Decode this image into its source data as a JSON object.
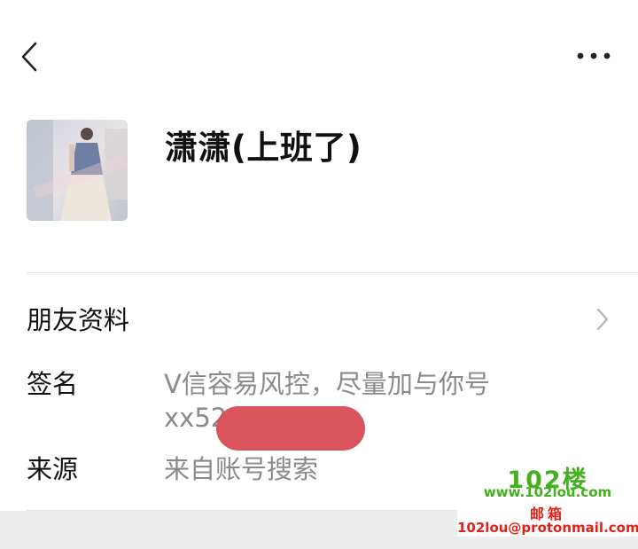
{
  "header": {
    "back_icon": "chevron-left-icon",
    "more_icon": "more-horizontal-icon"
  },
  "profile": {
    "avatar_icon": "avatar-photo",
    "nickname": "潇潇(上班了)"
  },
  "friend_info": {
    "label": "朋友资料",
    "chevron_icon": "chevron-right-icon"
  },
  "signature": {
    "label": "签名",
    "line1": "V信容易风控，尽量加与你号",
    "line2": "xx52"
  },
  "source": {
    "label": "来源",
    "value": "来自账号搜索"
  },
  "watermark": {
    "brand": "102楼",
    "site": "www.102lou.com",
    "mail_label": "邮箱",
    "mail": "102lou@protonmail.com"
  },
  "colors": {
    "redaction": "#d9545c",
    "watermark_green": "#44b01e",
    "watermark_red": "#e2231a"
  }
}
